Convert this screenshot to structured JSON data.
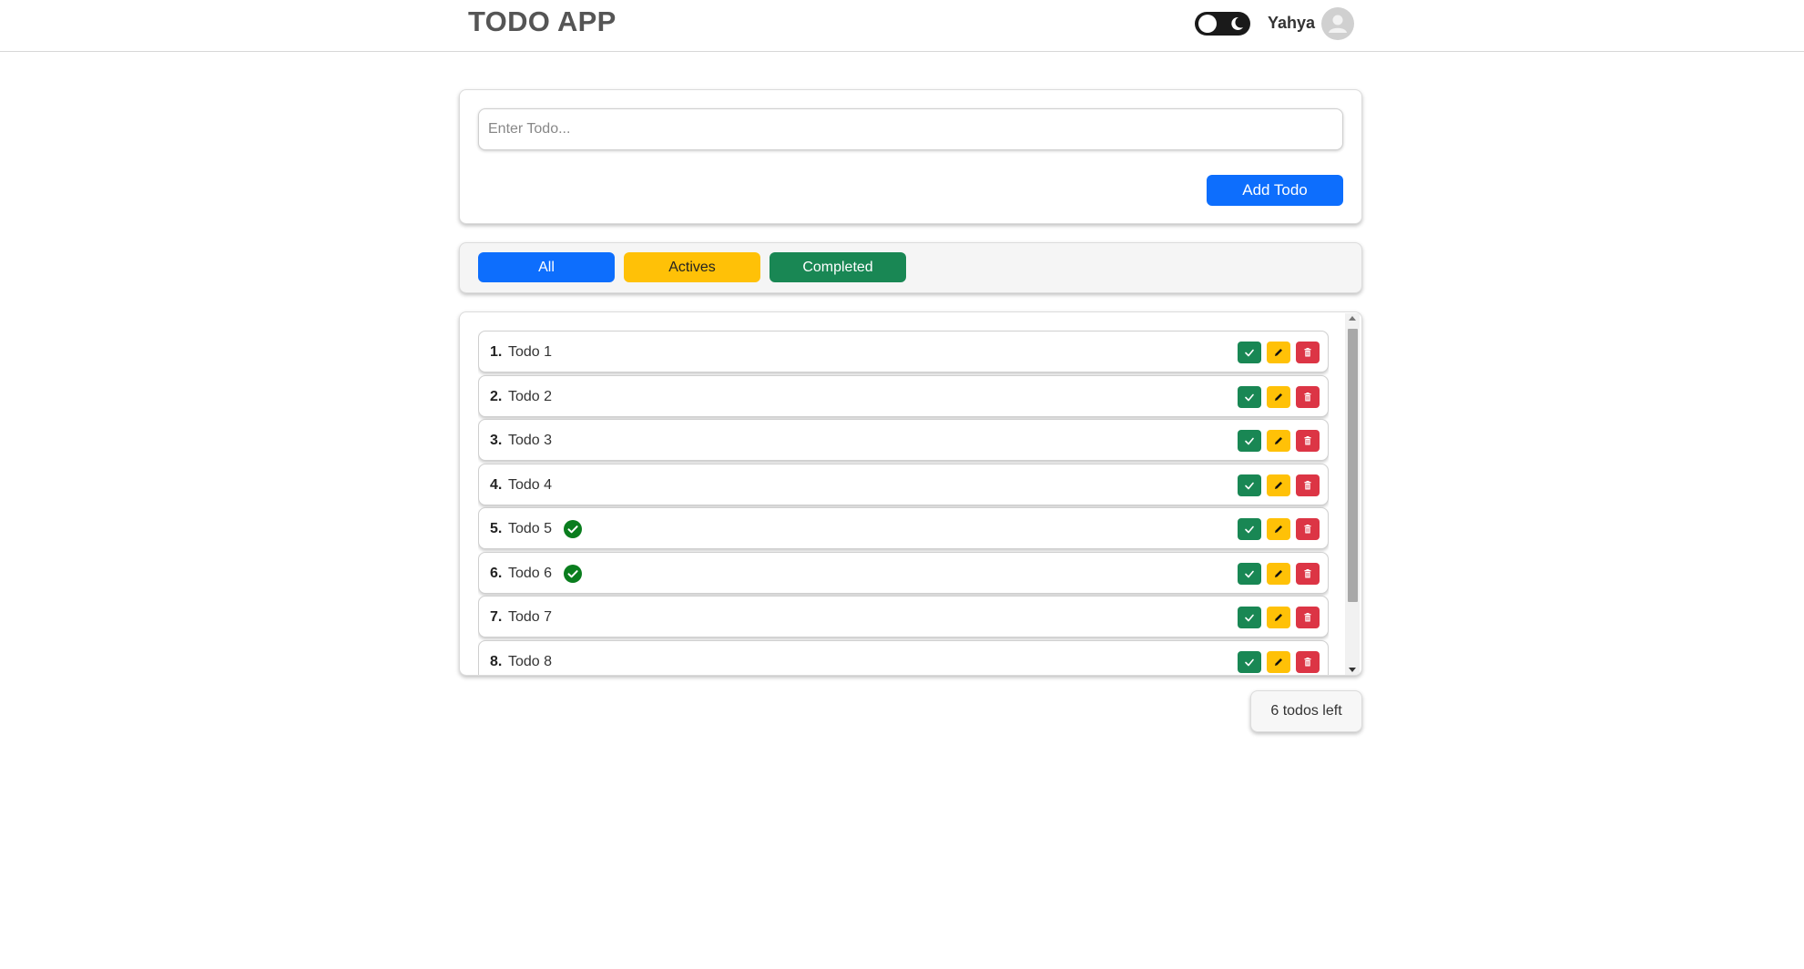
{
  "header": {
    "app_title": "TODO APP",
    "user_name": "Yahya",
    "theme_toggle_icons": [
      "light-knob-icon",
      "moon-icon"
    ],
    "avatar_icon": "user-avatar-icon"
  },
  "add_form": {
    "input_placeholder": "Enter Todo...",
    "input_value": "",
    "add_button_label": "Add Todo"
  },
  "filters": {
    "all_label": "All",
    "actives_label": "Actives",
    "completed_label": "Completed"
  },
  "todos": [
    {
      "number": "1.",
      "text": "Todo 1",
      "completed": false
    },
    {
      "number": "2.",
      "text": "Todo 2",
      "completed": false
    },
    {
      "number": "3.",
      "text": "Todo 3",
      "completed": false
    },
    {
      "number": "4.",
      "text": "Todo 4",
      "completed": false
    },
    {
      "number": "5.",
      "text": "Todo 5",
      "completed": true
    },
    {
      "number": "6.",
      "text": "Todo 6",
      "completed": true
    },
    {
      "number": "7.",
      "text": "Todo 7",
      "completed": false
    },
    {
      "number": "8.",
      "text": "Todo 8",
      "completed": false
    }
  ],
  "todo_action_icons": [
    "check-icon",
    "pencil-icon",
    "trash-icon"
  ],
  "footer": {
    "remaining_label": "6 todos left"
  },
  "colors": {
    "primary": "#0d6efd",
    "warning": "#ffc107",
    "success": "#198754",
    "danger": "#dc3545",
    "done_mark": "#0a7d1e"
  }
}
